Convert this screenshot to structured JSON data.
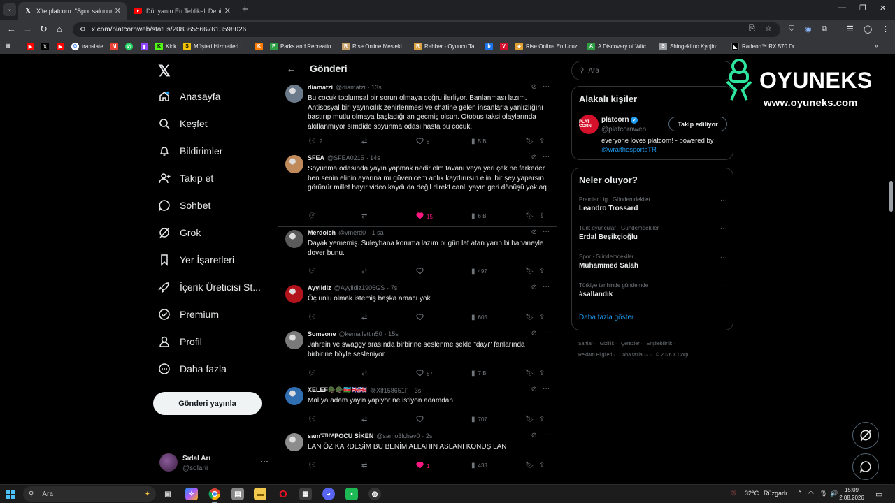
{
  "browser": {
    "tabs": [
      {
        "title": "X'te platcorn: \"Spor salonunda",
        "favicon": "x-logo-icon",
        "active": true
      },
      {
        "title": "Dünyanın En Tehlikeli Deniz Can",
        "favicon": "youtube-icon",
        "active": false
      }
    ],
    "url": "x.com/platcornweb/status/2083655667613598026",
    "bookmarks": [
      {
        "label": "",
        "icon": "youtube-icon",
        "color": "#ff0000"
      },
      {
        "label": "",
        "icon": "x-logo-icon",
        "color": "#000000"
      },
      {
        "label": "",
        "icon": "youtube-icon",
        "color": "#ff0000"
      },
      {
        "label": "translate",
        "icon": "google-icon",
        "color": "#ffffff"
      },
      {
        "label": "",
        "icon": "gmail-icon",
        "color": "#ea4335"
      },
      {
        "label": "",
        "icon": "whatsapp-icon",
        "color": "#25d366"
      },
      {
        "label": "",
        "icon": "twitch-icon",
        "color": "#9146ff"
      },
      {
        "label": "Kick",
        "icon": "kick-icon",
        "color": "#53fc18"
      },
      {
        "label": "Müşteri Hizmetleri İ...",
        "icon": "s-icon",
        "color": "#f2c200"
      },
      {
        "label": "",
        "icon": "k-icon",
        "color": "#ff7a00"
      },
      {
        "label": "Parks and Recreatio...",
        "icon": "parks-icon",
        "color": "#2ea043"
      },
      {
        "label": "Rise Online Meslekl...",
        "icon": "rise-icon",
        "color": "#c8a26b"
      },
      {
        "label": "Rehber - Oyuncu Ta...",
        "icon": "rehber-icon",
        "color": "#d9a441"
      },
      {
        "label": "",
        "icon": "b-icon",
        "color": "#1a73e8"
      },
      {
        "label": "",
        "icon": "v-icon",
        "color": "#d4102a"
      },
      {
        "label": "Rise Online En Ucuz...",
        "icon": "shop-icon",
        "color": "#e0a030"
      },
      {
        "label": "A Discovery of Witc...",
        "icon": "parks-icon",
        "color": "#2ea043"
      },
      {
        "label": "Shingeki no Kyojin:...",
        "icon": "snk-icon",
        "color": "#9aa0a6"
      },
      {
        "label": "Radeon™ RX 570 Dr...",
        "icon": "amd-icon",
        "color": "#000000"
      }
    ]
  },
  "sidebar": {
    "items": [
      {
        "label": "Anasayfa",
        "icon": "home-icon"
      },
      {
        "label": "Keşfet",
        "icon": "search-icon"
      },
      {
        "label": "Bildirimler",
        "icon": "bell-icon"
      },
      {
        "label": "Takip et",
        "icon": "follow-icon"
      },
      {
        "label": "Sohbet",
        "icon": "chat-icon"
      },
      {
        "label": "Grok",
        "icon": "grok-icon"
      },
      {
        "label": "Yer İşaretleri",
        "icon": "bookmark-icon"
      },
      {
        "label": "İçerik Üreticisi St...",
        "icon": "rocket-icon"
      },
      {
        "label": "Premium",
        "icon": "premium-icon"
      },
      {
        "label": "Profil",
        "icon": "person-icon"
      },
      {
        "label": "Daha fazla",
        "icon": "more-circle-icon"
      }
    ],
    "post_button": "Gönderi yayınla",
    "account": {
      "name": "Sıdal Arı",
      "handle": "@sdlarii"
    }
  },
  "main": {
    "title": "Gönderi",
    "replies": [
      {
        "name": "diamatzi",
        "handle": "@diamatzi",
        "time": "· 13s",
        "text": "Bu cocuk toplumsal bir sorun olmaya doğru ilerliyor. Banlanması lazım. Antisosyal biri yayıncılık zehirlenmesi ve chatine gelen insanlarla yanlızlığını bastırıp mutlu olmaya başladığı an gecmiş olsun. Otobus taksi olaylarında akıllanmıyor sımdide soyunma odası hasta bu cocuk.",
        "replies": "2",
        "retweets": "",
        "likes": "6",
        "views": "5 B",
        "liked": false,
        "avatar": "#6b7b8c"
      },
      {
        "name": "SFEA",
        "handle": "@SFEA0215",
        "time": "· 14s",
        "text": "Soyunma odasında yayın yapmak nedir olm tavanı veya yeri çek ne farkeder ben senin elinin ayarına mı güvenicem anlık kaydırırsın elini bir şey yaparsın görünür millet hayır video kaydı da değil direkt canlı yayın geri dönüşü yok aq",
        "replies": "",
        "retweets": "",
        "likes": "15",
        "views": "6 B",
        "liked": true,
        "avatar": "#c08a5a"
      },
      {
        "name": "Merdoich",
        "handle": "@vmerd0",
        "time": "· 1 sa",
        "text": "Dayak yememiş. Suleyhana koruma lazım bugün laf atan yarın bi bahaneyle dover bunu.",
        "replies": "",
        "retweets": "",
        "likes": "",
        "views": "497",
        "liked": false,
        "avatar": "#5a5a5a"
      },
      {
        "name": "Ayyildiz",
        "handle": "@Ayyildiz1905GS",
        "time": "· 7s",
        "text": "Öç ünlü olmak istemiş başka amacı yok",
        "replies": "",
        "retweets": "",
        "likes": "",
        "views": "605",
        "liked": false,
        "avatar": "#b3141c"
      },
      {
        "name": "Someone",
        "handle": "@kemallettin50",
        "time": "· 15s",
        "text": "Jahrein ve swaggy arasında birbirine seslenme şekle \"dayı\" fanlarında birbirine böyle sesleniyor",
        "replies": "",
        "retweets": "",
        "likes": "67",
        "views": "7 B",
        "liked": false,
        "avatar": "#7a7a7a"
      },
      {
        "name": "XELEF🪖🪖🇦🇿🇬🇧🇬🇧",
        "handle": "@Xlf158651F",
        "time": "· 3s",
        "text": "Mal ya adam yayin yapiyor ne istiyon adamdan",
        "replies": "",
        "retweets": "",
        "likes": "",
        "views": "707",
        "liked": false,
        "avatar": "#2f6fb2"
      },
      {
        "name": "sam'ᴱᵀᴴ'ᴬPOCU SİKEN",
        "handle": "@samo3lchav0",
        "time": "· 2s",
        "text": "LAN ÖZ KARDEŞİM BU BENİM ALLAHIN ASLANI KONUŞ LAN",
        "replies": "",
        "retweets": "",
        "likes": "1",
        "views": "433",
        "liked": true,
        "avatar": "#8c8c8c"
      }
    ]
  },
  "right": {
    "search_placeholder": "Ara",
    "related": {
      "title": "Alakalı kişiler",
      "name": "platcorn",
      "handle": "@platcornweb",
      "follow_label": "Takip ediliyor",
      "bio": "everyone loves platcorn! - powered by",
      "bio_mention": "@wraithesportsTR",
      "avatar_text": "PLAT CORN"
    },
    "trends": {
      "title": "Neler oluyor?",
      "items": [
        {
          "category": "Premier Lig · Gündemdekiler",
          "name": "Leandro Trossard"
        },
        {
          "category": "Türk oyuncular · Gündemdekiler",
          "name": "Erdal Beşikçioğlu"
        },
        {
          "category": "Spor · Gündemdekiler",
          "name": "Muhammed Salah"
        },
        {
          "category": "Türkiye tarihinde gündemde",
          "name": "#sallandık"
        }
      ],
      "show_more": "Daha fazla göster"
    },
    "footer": [
      "Şartlar",
      "Gizlilik",
      "Çerezler",
      "Erişilebilirlik",
      "Reklam Bilgileri",
      "Daha fazla ···",
      "© 2026 X Corp."
    ]
  },
  "brand": {
    "word": "OYUNEKS",
    "url": "www.oyuneks.com"
  },
  "taskbar": {
    "search_placeholder": "Ara",
    "weather": "32°C",
    "weather_label": "Rüzgarlı",
    "time": "15:09",
    "date": "2.08.2026"
  },
  "colors": {
    "accent": "#1d9bf0",
    "like": "#f91880",
    "background": "#000000"
  }
}
